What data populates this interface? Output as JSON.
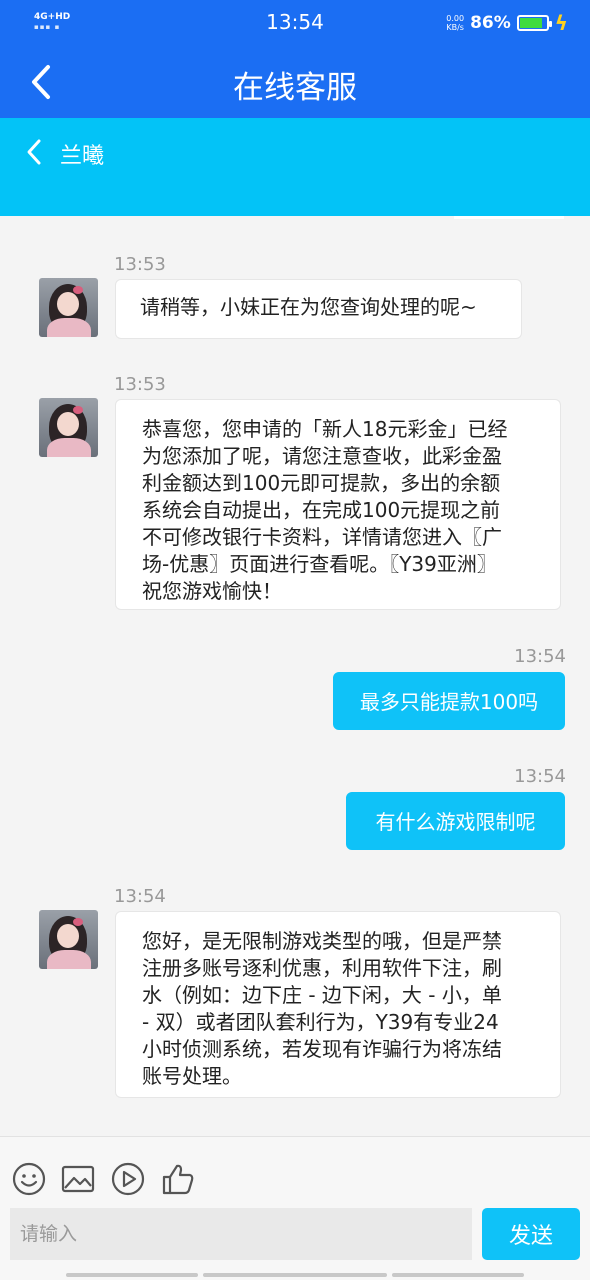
{
  "status_bar": {
    "network": "4G+HD",
    "signal_sub": "▪▪▪ ▪",
    "time": "13:54",
    "net_speed_value": "0.00",
    "net_speed_unit": "KB/s",
    "battery": "86%",
    "battery_level": 0.86,
    "battery_color": "#3fdc3f"
  },
  "header": {
    "title": "在线客服"
  },
  "subheader": {
    "agent_name": "兰曦"
  },
  "colors": {
    "primary": "#1b6ef3",
    "accent": "#03c3f7",
    "bubble_out": "#0fc2f8"
  },
  "messages": [
    {
      "time": "13:53",
      "direction": "in",
      "lines": [
        "请稍等，小妹正在为您查询处理的呢~"
      ]
    },
    {
      "time": "13:53",
      "direction": "in",
      "lines": [
        "恭喜您，您申请的「新人18元彩金」已经",
        "为您添加了呢，请您注意查收，此彩金盈",
        "利金额达到100元即可提款，多出的余额",
        "系统会自动提出，在完成100元提现之前",
        "不可修改银行卡资料，详情请您进入〖广",
        "场-优惠〗页面进行查看呢。〖Y39亚洲〗",
        "祝您游戏愉快！"
      ]
    },
    {
      "time": "13:54",
      "direction": "out",
      "lines": [
        "最多只能提款100吗"
      ]
    },
    {
      "time": "13:54",
      "direction": "out",
      "lines": [
        "有什么游戏限制呢"
      ]
    },
    {
      "time": "13:54",
      "direction": "in",
      "lines": [
        "您好，是无限制游戏类型的哦，但是严禁",
        "注册多账号逐利优惠，利用软件下注，刷",
        "水（例如：边下庄 - 边下闲，大 - 小，单",
        "- 双）或者团队套利行为，Y39有专业24",
        "小时侦测系统，若发现有诈骗行为将冻结",
        "账号处理。"
      ]
    }
  ],
  "toolbar": {
    "icons": [
      "smiley-icon",
      "image-icon",
      "play-icon",
      "thumbs-up-icon"
    ],
    "input_placeholder": "请输入",
    "send_label": "发送"
  }
}
